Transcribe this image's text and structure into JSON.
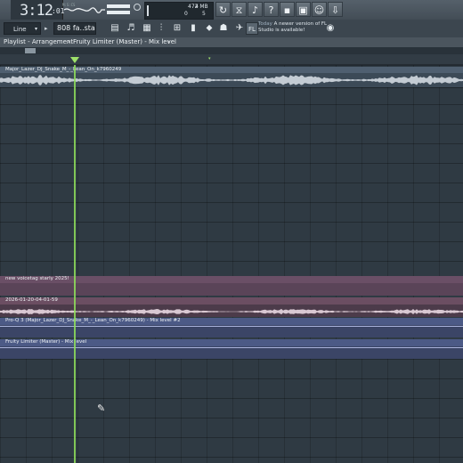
{
  "toolbar": {
    "time_main": "3:12",
    "time_sub": ":01",
    "time_mark": "M:S:CS",
    "cpu_value": "4",
    "memory": "472 MB",
    "voices": "5",
    "voices_label": "0"
  },
  "toolbar2": {
    "snap_mode": "Line",
    "pattern": "808 fa..starly",
    "news_today": "Today",
    "news_text": "A newer version of FL Studio is available!"
  },
  "titlebar": {
    "window": "Playlist - Arrangement",
    "separator": "›",
    "context": "Fruity Limiter (Master) - Mix level",
    "separator2": "›"
  },
  "playlist": {
    "clips": [
      {
        "name": "Major_Lazer_DJ_Snake_M_-_Lean_On_k7960249",
        "kind": "audio"
      },
      {
        "name": "new voicetag starly 2025!",
        "kind": "audio"
      },
      {
        "name": "2026-01-20-04-01-59",
        "kind": "audio"
      },
      {
        "name": "Pro-Q 3 (Major_Lazer_DJ_Snake_M_-_Lean_On_k7960249) - Mix level #2",
        "kind": "automation"
      },
      {
        "name": "Fruity Limiter (Master) - Mix level",
        "kind": "automation"
      }
    ]
  },
  "icons": [
    "record-icon",
    "pattern-song-icon",
    "undo-icon",
    "cut-icon",
    "mic-icon",
    "help-icon",
    "save-icon",
    "render-icon",
    "chat-icon",
    "download-icon"
  ],
  "colors": {
    "playhead": "#8fe05a",
    "audio_clip_bg": "#4a5a6a",
    "pink_clip_bg": "#6a4f66",
    "automation_bg": "#4b5678"
  }
}
